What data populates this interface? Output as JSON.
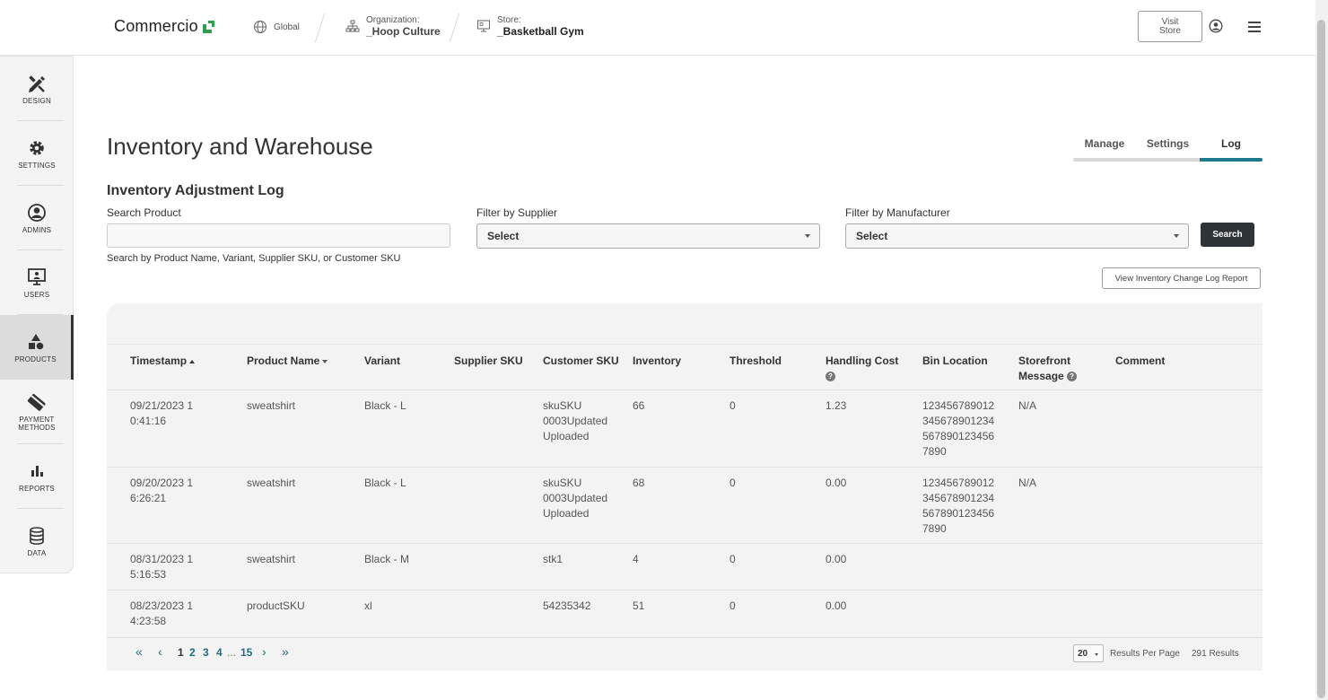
{
  "header": {
    "logo_text": "Commercio",
    "global_label": "Global",
    "org_small": "Organization:",
    "org_name": "_Hoop Culture",
    "store_small": "Store:",
    "store_name": "_Basketball Gym",
    "visit_store": "Visit Store"
  },
  "sidebar": {
    "items": [
      {
        "label": "DESIGN"
      },
      {
        "label": "SETTINGS"
      },
      {
        "label": "ADMINS"
      },
      {
        "label": "USERS"
      },
      {
        "label": "PRODUCTS"
      },
      {
        "label": "PAYMENT METHODS"
      },
      {
        "label": "REPORTS"
      },
      {
        "label": "DATA"
      }
    ]
  },
  "page": {
    "title": "Inventory and Warehouse",
    "tabs": [
      {
        "label": "Manage"
      },
      {
        "label": "Settings"
      },
      {
        "label": "Log"
      }
    ],
    "section_title": "Inventory Adjustment Log"
  },
  "filters": {
    "search_label": "Search Product",
    "search_value": "",
    "search_helper": "Search by Product Name, Variant, Supplier SKU, or Customer SKU",
    "supplier_label": "Filter by Supplier",
    "supplier_value": "Select",
    "manufacturer_label": "Filter by Manufacturer",
    "manufacturer_value": "Select",
    "search_button": "Search",
    "report_button": "View Inventory Change Log Report"
  },
  "table": {
    "columns": {
      "timestamp": "Timestamp",
      "product_name": "Product Name",
      "variant": "Variant",
      "supplier_sku": "Supplier SKU",
      "customer_sku": "Customer SKU",
      "inventory": "Inventory",
      "threshold": "Threshold",
      "handling_cost": "Handling Cost",
      "bin_location": "Bin Location",
      "storefront_message": "Storefront Message",
      "comment": "Comment",
      "help_glyph": "?"
    },
    "rows": [
      {
        "timestamp": "09/21/2023 10:41:16",
        "product_name": "sweatshirt",
        "variant": "Black - L",
        "supplier_sku": "",
        "customer_sku": "skuSKU 0003Updated Uploaded",
        "inventory": "66",
        "threshold": "0",
        "handling_cost": "1.23",
        "bin_location": "1234567890123456789012345678901234567890",
        "storefront_message": "N/A",
        "comment": ""
      },
      {
        "timestamp": "09/20/2023 16:26:21",
        "product_name": "sweatshirt",
        "variant": "Black - L",
        "supplier_sku": "",
        "customer_sku": "skuSKU 0003Updated Uploaded",
        "inventory": "68",
        "threshold": "0",
        "handling_cost": "0.00",
        "bin_location": "1234567890123456789012345678901234567890",
        "storefront_message": "N/A",
        "comment": ""
      },
      {
        "timestamp": "08/31/2023 15:16:53",
        "product_name": "sweatshirt",
        "variant": "Black - M",
        "supplier_sku": "",
        "customer_sku": "stk1",
        "inventory": "4",
        "threshold": "0",
        "handling_cost": "0.00",
        "bin_location": "",
        "storefront_message": "",
        "comment": ""
      },
      {
        "timestamp": "08/23/2023 14:23:58",
        "product_name": "productSKU",
        "variant": "xl",
        "supplier_sku": "",
        "customer_sku": "54235342",
        "inventory": "51",
        "threshold": "0",
        "handling_cost": "0.00",
        "bin_location": "",
        "storefront_message": "",
        "comment": ""
      }
    ]
  },
  "pagination": {
    "first": "«",
    "prev": "‹",
    "pages": [
      "1",
      "2",
      "3",
      "4"
    ],
    "ellipsis": "...",
    "last_page": "15",
    "next": "›",
    "last": "»",
    "per_page": "20",
    "per_page_label": "Results Per Page",
    "total": "291 Results"
  }
}
